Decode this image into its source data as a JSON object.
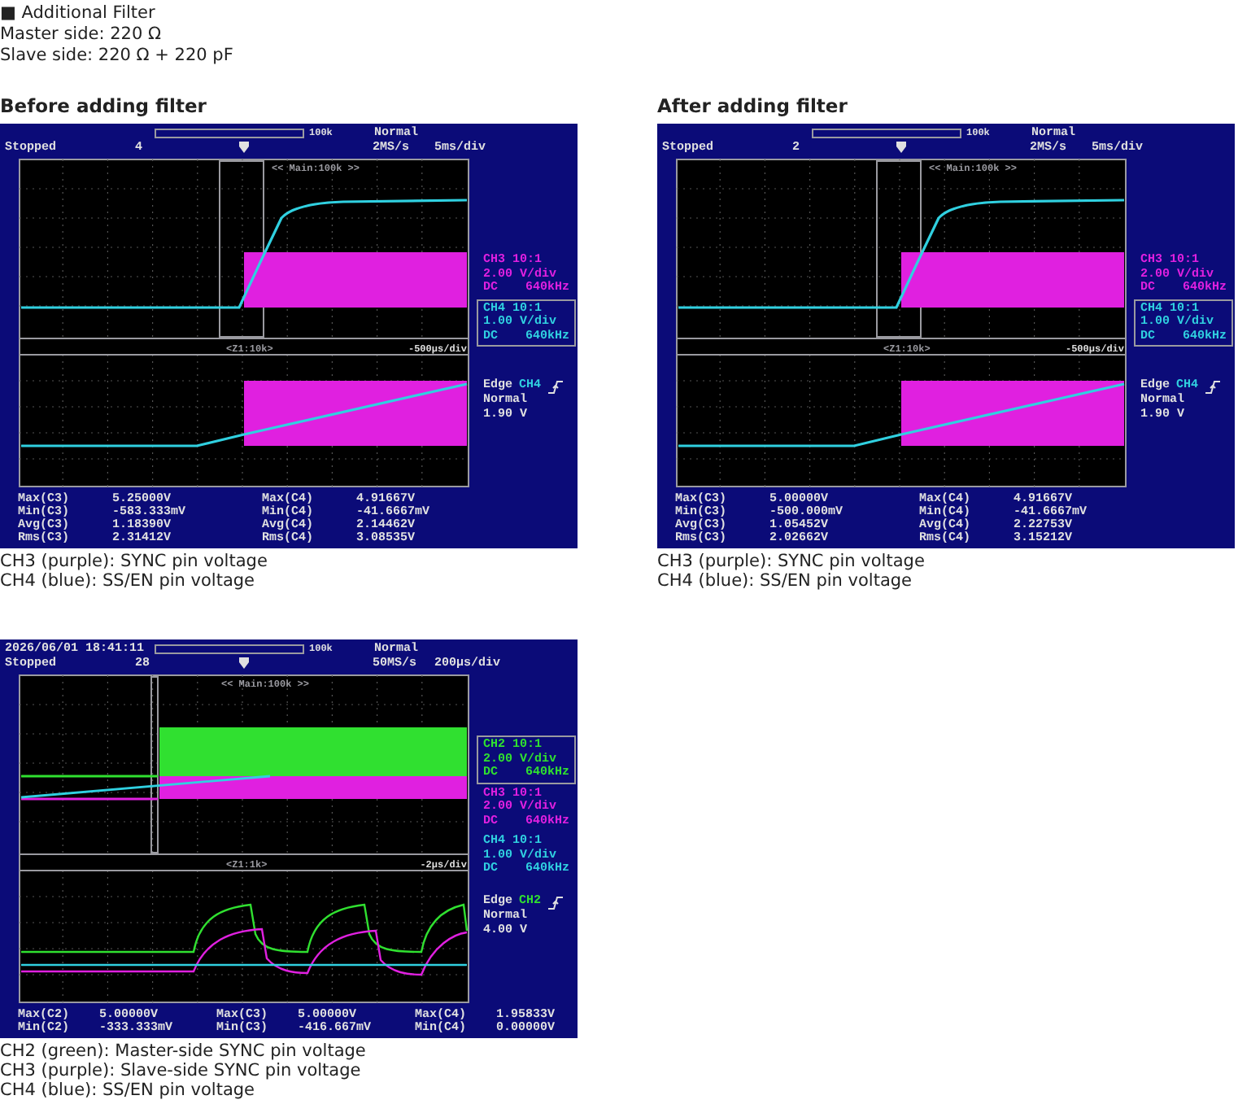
{
  "intro": {
    "heading": "■ Additional Filter",
    "lines": [
      "Master side: 220 Ω",
      "Slave side: 220 Ω + 220 pF"
    ]
  },
  "captures": [
    {
      "title": "Before adding filter",
      "scope": {
        "memory": "100k",
        "trigger_mode": "Normal",
        "status": "Stopped",
        "count": "4",
        "sample_rate": "2MS/s",
        "timebase": "5ms/div",
        "main_label": "<< Main:100k >>",
        "zoom_label": "<Z1:10k>",
        "zoom_timebase": "-500μs/div",
        "channels": [
          {
            "name": "CH3 10:1",
            "scale": "2.00 V/div",
            "coupling": "DC",
            "bandwidth": "640kHz",
            "color": "#e020e0",
            "selected": false
          },
          {
            "name": "CH4 10:1",
            "scale": "1.00 V/div",
            "coupling": "DC",
            "bandwidth": "640kHz",
            "color": "#30d0e0",
            "selected": true
          }
        ],
        "trigger": {
          "type": "Edge",
          "source": "CH4",
          "color": "#30d0e0",
          "mode": "Normal",
          "level": "1.90 V"
        },
        "measurements": [
          [
            "Max(C3)",
            "5.25000V",
            "Max(C4)",
            "4.91667V"
          ],
          [
            "Min(C3)",
            "-583.333mV",
            "Min(C4)",
            "-41.6667mV"
          ],
          [
            "Avg(C3)",
            "1.18390V",
            "Avg(C4)",
            "2.14462V"
          ],
          [
            "Rms(C3)",
            "2.31412V",
            "Rms(C4)",
            "3.08535V"
          ]
        ]
      },
      "captions": [
        "CH3 (purple): SYNC pin voltage",
        "CH4 (blue): SS/EN pin voltage"
      ]
    },
    {
      "title": "After adding filter",
      "scope": {
        "memory": "100k",
        "trigger_mode": "Normal",
        "status": "Stopped",
        "count": "2",
        "sample_rate": "2MS/s",
        "timebase": "5ms/div",
        "main_label": "<< Main:100k >>",
        "zoom_label": "<Z1:10k>",
        "zoom_timebase": "-500μs/div",
        "channels": [
          {
            "name": "CH3 10:1",
            "scale": "2.00 V/div",
            "coupling": "DC",
            "bandwidth": "640kHz",
            "color": "#e020e0",
            "selected": false
          },
          {
            "name": "CH4 10:1",
            "scale": "1.00 V/div",
            "coupling": "DC",
            "bandwidth": "640kHz",
            "color": "#30d0e0",
            "selected": true
          }
        ],
        "trigger": {
          "type": "Edge",
          "source": "CH4",
          "color": "#30d0e0",
          "mode": "Normal",
          "level": "1.90 V"
        },
        "measurements": [
          [
            "Max(C3)",
            "5.00000V",
            "Max(C4)",
            "4.91667V"
          ],
          [
            "Min(C3)",
            "-500.000mV",
            "Min(C4)",
            "-41.6667mV"
          ],
          [
            "Avg(C3)",
            "1.05452V",
            "Avg(C4)",
            "2.22753V"
          ],
          [
            "Rms(C3)",
            "2.02662V",
            "Rms(C4)",
            "3.15212V"
          ]
        ]
      },
      "captions": [
        "CH3 (purple): SYNC pin voltage",
        "CH4 (blue): SS/EN pin voltage"
      ]
    },
    {
      "scope": {
        "datetime": "2026/06/01 18:41:11",
        "memory": "100k",
        "trigger_mode": "Normal",
        "status": "Stopped",
        "count": "28",
        "sample_rate": "50MS/s",
        "timebase": "200μs/div",
        "main_label": "<< Main:100k >>",
        "zoom_label": "<Z1:1k>",
        "zoom_timebase": "-2μs/div",
        "channels": [
          {
            "name": "CH2 10:1",
            "scale": "2.00 V/div",
            "coupling": "DC",
            "bandwidth": "640kHz",
            "color": "#30e030",
            "selected": true
          },
          {
            "name": "CH3 10:1",
            "scale": "2.00 V/div",
            "coupling": "DC",
            "bandwidth": "640kHz",
            "color": "#e020e0",
            "selected": false
          },
          {
            "name": "CH4 10:1",
            "scale": "1.00 V/div",
            "coupling": "DC",
            "bandwidth": "640kHz",
            "color": "#30d0e0",
            "selected": false
          }
        ],
        "trigger": {
          "type": "Edge",
          "source": "CH2",
          "color": "#30e030",
          "mode": "Normal",
          "level": "4.00 V"
        },
        "measurements": [
          [
            "Max(C2)",
            "5.00000V",
            "Max(C3)",
            "5.00000V",
            "Max(C4)",
            "1.95833V"
          ],
          [
            "Min(C2)",
            "-333.333mV",
            "Min(C3)",
            "-416.667mV",
            "Min(C4)",
            "0.00000V"
          ]
        ]
      },
      "captions": [
        "CH2 (green): Master-side SYNC pin voltage",
        "CH3 (purple): Slave-side SYNC pin voltage",
        "CH4 (blue): SS/EN pin voltage"
      ]
    }
  ]
}
